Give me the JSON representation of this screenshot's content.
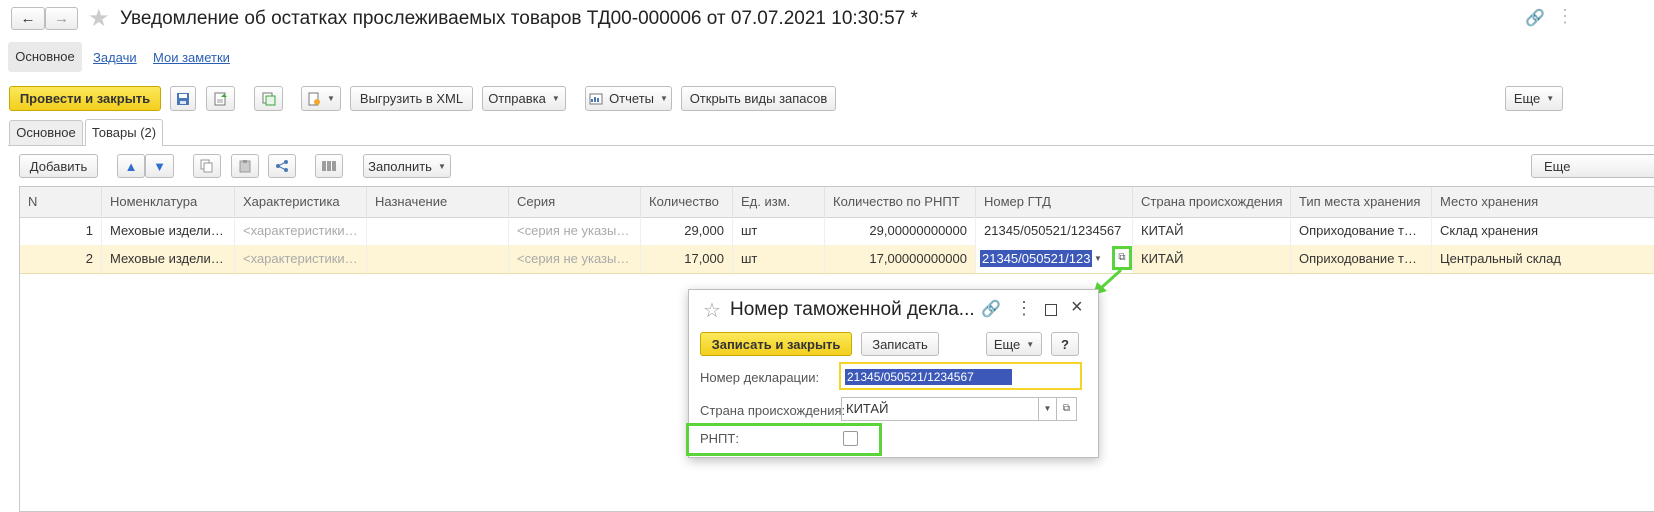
{
  "window": {
    "title": "Уведомление об остатках прослеживаемых товаров ТД00-000006 от 07.07.2021 10:30:57 *"
  },
  "nav_tabs": {
    "main": "Основное",
    "tasks": "Задачи",
    "notes": "Мои заметки"
  },
  "toolbar": {
    "post_close": "Провести и закрыть",
    "export_xml": "Выгрузить в XML",
    "send": "Отправка",
    "reports": "Отчеты",
    "open_stock_types": "Открыть виды запасов",
    "more": "Еще"
  },
  "form_tabs": {
    "main": "Основное",
    "goods": "Товары (2)"
  },
  "goods_toolbar": {
    "add": "Добавить",
    "fill": "Заполнить",
    "more": "Еще"
  },
  "table": {
    "columns": [
      "N",
      "Номенклатура",
      "Характеристика",
      "Назначение",
      "Серия",
      "Количество",
      "Ед. изм.",
      "Количество по РНПТ",
      "Номер ГТД",
      "Страна происхождения",
      "Тип места хранения",
      "Место хранения"
    ],
    "rows": [
      {
        "n": "1",
        "item": "Меховые изделия...",
        "characteristic": "<характеристики ...",
        "purpose": "",
        "series": "<серия не указыв...",
        "qty": "29,000",
        "unit": "шт",
        "qty_rnpt": "29,00000000000",
        "gtd": "21345/050521/1234567",
        "country": "КИТАЙ",
        "storage_type": "Оприходование тов...",
        "storage_place": "Склад хранения"
      },
      {
        "n": "2",
        "item": "Меховые изделия...",
        "characteristic": "<характеристики ...",
        "purpose": "",
        "series": "<серия не указыв...",
        "qty": "17,000",
        "unit": "шт",
        "qty_rnpt": "17,00000000000",
        "gtd": "21345/050521/123",
        "country": "КИТАЙ",
        "storage_type": "Оприходование тов...",
        "storage_place": "Центральный склад"
      }
    ]
  },
  "dialog": {
    "title": "Номер таможенной декла...",
    "save_close": "Записать и закрыть",
    "save": "Записать",
    "more": "Еще",
    "help": "?",
    "decl_label": "Номер декларации:",
    "decl_value": "21345/050521/1234567",
    "country_label": "Страна происхождения:",
    "country_value": "КИТАЙ",
    "rnpt_label": "РНПТ:"
  },
  "colors": {
    "accent_yellow": "#f5d327",
    "highlight_green": "#5ad43a",
    "selection_blue": "#3c58b8",
    "row_selected": "#fdf5d6"
  }
}
